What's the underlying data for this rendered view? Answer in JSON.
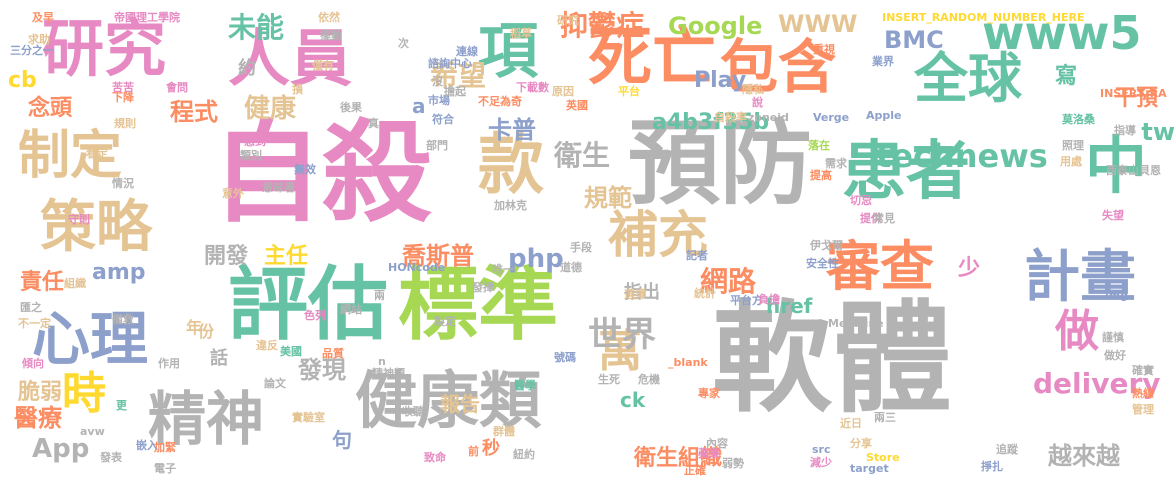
{
  "palette": {
    "pink": "#e78ac3",
    "gray": "#b3b3b3",
    "green": "#66c2a5",
    "tan": "#e5c494",
    "blue": "#8da0cb",
    "orange": "#fc8d62",
    "yellow": "#ffd92f",
    "lime": "#a6d854"
  },
  "words": [
    {
      "text": "自殺",
      "color": "pink"
    },
    {
      "text": "軟體",
      "color": "gray"
    },
    {
      "text": "預防",
      "color": "gray"
    },
    {
      "text": "評估",
      "color": "green"
    },
    {
      "text": "標準",
      "color": "lime"
    },
    {
      "text": "研究",
      "color": "pink"
    },
    {
      "text": "人員",
      "color": "pink"
    },
    {
      "text": "款",
      "color": "tan"
    },
    {
      "text": "患者",
      "color": "green"
    },
    {
      "text": "中",
      "color": "green"
    },
    {
      "text": "精神",
      "color": "gray"
    },
    {
      "text": "健康類",
      "color": "gray"
    },
    {
      "text": "心理",
      "color": "blue"
    },
    {
      "text": "策略",
      "color": "tan"
    },
    {
      "text": "制定",
      "color": "tan"
    },
    {
      "text": "死亡",
      "color": "orange"
    },
    {
      "text": "包含",
      "color": "orange"
    },
    {
      "text": "項",
      "color": "green"
    },
    {
      "text": "全球",
      "color": "green"
    },
    {
      "text": "www5",
      "color": "green"
    },
    {
      "text": "補充",
      "color": "tan"
    },
    {
      "text": "審查",
      "color": "orange"
    },
    {
      "text": "計畫",
      "color": "blue"
    },
    {
      "text": "時",
      "color": "yellow"
    },
    {
      "text": "做",
      "color": "pink"
    },
    {
      "text": "萬",
      "color": "tan"
    },
    {
      "text": "世界",
      "color": "gray"
    },
    {
      "text": "technews",
      "color": "green"
    },
    {
      "text": "delivery",
      "color": "pink"
    },
    {
      "text": "網路",
      "color": "orange"
    },
    {
      "text": "希望",
      "color": "tan"
    },
    {
      "text": "抑鬱症",
      "color": "orange"
    },
    {
      "text": "Google",
      "color": "lime"
    },
    {
      "text": "WWW",
      "color": "tan"
    },
    {
      "text": "BMC",
      "color": "blue"
    },
    {
      "text": "未能",
      "color": "green"
    },
    {
      "text": "健康",
      "color": "tan"
    },
    {
      "text": "程式",
      "color": "orange"
    },
    {
      "text": "衛生",
      "color": "gray"
    },
    {
      "text": "卡普",
      "color": "blue"
    },
    {
      "text": "規範",
      "color": "tan"
    },
    {
      "text": "a4b3f35b",
      "color": "green"
    },
    {
      "text": "Play",
      "color": "blue"
    },
    {
      "text": "喬斯普",
      "color": "orange"
    },
    {
      "text": "php",
      "color": "blue"
    },
    {
      "text": "amp",
      "color": "blue"
    },
    {
      "text": "開發",
      "color": "gray"
    },
    {
      "text": "主任",
      "color": "yellow"
    },
    {
      "text": "發現",
      "color": "gray"
    },
    {
      "text": "醫療",
      "color": "orange"
    },
    {
      "text": "脆弱",
      "color": "tan"
    },
    {
      "text": "責任",
      "color": "orange"
    },
    {
      "text": "App",
      "color": "gray"
    },
    {
      "text": "越來越",
      "color": "gray"
    },
    {
      "text": "衛生組織",
      "color": "orange"
    },
    {
      "text": "念頭",
      "color": "orange"
    },
    {
      "text": "cb",
      "color": "yellow"
    },
    {
      "text": "tw",
      "color": "green"
    },
    {
      "text": "干預",
      "color": "orange"
    },
    {
      "text": "寫",
      "color": "green"
    },
    {
      "text": "報告",
      "color": "tan"
    },
    {
      "text": "href",
      "color": "green"
    },
    {
      "text": "指出",
      "color": "gray"
    },
    {
      "text": "少",
      "color": "pink"
    },
    {
      "text": "年",
      "color": "tan"
    },
    {
      "text": "話",
      "color": "gray"
    },
    {
      "text": "句",
      "color": "blue"
    },
    {
      "text": "ck",
      "color": "green"
    },
    {
      "text": "a",
      "color": "blue"
    },
    {
      "text": "秒",
      "color": "orange"
    },
    {
      "text": "份",
      "color": "tan"
    },
    {
      "text": "約",
      "color": "gray"
    },
    {
      "text": "INSERT_RANDOM_NUMBER_HERE",
      "color": "yellow"
    },
    {
      "text": "帝國理工學院",
      "color": "pink"
    },
    {
      "text": "依然",
      "color": "tan"
    },
    {
      "text": "研究",
      "color": "tan"
    },
    {
      "text": "及早",
      "color": "orange"
    },
    {
      "text": "求助",
      "color": "tan"
    },
    {
      "text": "三分之一",
      "color": "blue"
    },
    {
      "text": "苦苦",
      "color": "pink"
    },
    {
      "text": "僅有",
      "color": "tan"
    },
    {
      "text": "市場",
      "color": "blue"
    },
    {
      "text": "連線",
      "color": "blue"
    },
    {
      "text": "次",
      "color": "gray"
    },
    {
      "text": "下載數",
      "color": "pink"
    },
    {
      "text": "原因",
      "color": "tan"
    },
    {
      "text": "英國",
      "color": "orange"
    },
    {
      "text": "平台",
      "color": "yellow"
    },
    {
      "text": "Apple",
      "color": "blue"
    },
    {
      "text": "重視",
      "color": "orange"
    },
    {
      "text": "業界",
      "color": "blue"
    },
    {
      "text": "INSERT_RA",
      "color": "orange"
    },
    {
      "text": "指導",
      "color": "gray"
    },
    {
      "text": "莫洛桑",
      "color": "green"
    },
    {
      "text": "照理",
      "color": "gray"
    },
    {
      "text": "用處",
      "color": "tan"
    },
    {
      "text": "西泰山貝恩",
      "color": "gray"
    },
    {
      "text": "Verge",
      "color": "blue"
    },
    {
      "text": "zoneid",
      "color": "gray"
    },
    {
      "text": "自殺率",
      "color": "tan"
    },
    {
      "text": "提高",
      "color": "orange"
    },
    {
      "text": "需求",
      "color": "gray"
    },
    {
      "text": "落在",
      "color": "lime"
    },
    {
      "text": "切忌",
      "color": "pink"
    },
    {
      "text": "提供",
      "color": "pink"
    },
    {
      "text": "失望",
      "color": "pink"
    },
    {
      "text": "常見",
      "color": "gray"
    },
    {
      "text": "img",
      "color": "blue"
    },
    {
      "text": "伊戈爾",
      "color": "gray"
    },
    {
      "text": "安全性",
      "color": "blue"
    },
    {
      "text": "記者",
      "color": "blue"
    },
    {
      "text": "手段",
      "color": "gray"
    },
    {
      "text": "道德",
      "color": "gray"
    },
    {
      "text": "唯一",
      "color": "gray"
    },
    {
      "text": "HONcode",
      "color": "blue"
    },
    {
      "text": "加林克",
      "color": "gray"
    },
    {
      "text": "統計",
      "color": "tan"
    },
    {
      "text": "選擇",
      "color": "tan"
    },
    {
      "text": "平台方",
      "color": "blue"
    },
    {
      "text": "負擔",
      "color": "pink"
    },
    {
      "text": "謹慎",
      "color": "gray"
    },
    {
      "text": "Medicine",
      "color": "gray"
    },
    {
      "text": "做好",
      "color": "gray"
    },
    {
      "text": "確實",
      "color": "gray"
    },
    {
      "text": "熱線",
      "color": "orange"
    },
    {
      "text": "管理",
      "color": "tan"
    },
    {
      "text": "兩三",
      "color": "gray"
    },
    {
      "text": "近日",
      "color": "tan"
    },
    {
      "text": "分享",
      "color": "tan"
    },
    {
      "text": "追蹤",
      "color": "gray"
    },
    {
      "text": "掙扎",
      "color": "blue"
    },
    {
      "text": "src",
      "color": "blue"
    },
    {
      "text": "Store",
      "color": "yellow"
    },
    {
      "text": "target",
      "color": "blue"
    },
    {
      "text": "減少",
      "color": "pink"
    },
    {
      "text": "弱勢",
      "color": "gray"
    },
    {
      "text": "正確",
      "color": "orange"
    },
    {
      "text": "蘋果",
      "color": "pink"
    },
    {
      "text": "專家",
      "color": "orange"
    },
    {
      "text": "內容",
      "color": "gray"
    },
    {
      "text": "危機",
      "color": "gray"
    },
    {
      "text": "_blank",
      "color": "orange"
    },
    {
      "text": "生死",
      "color": "gray"
    },
    {
      "text": "號碼",
      "color": "blue"
    },
    {
      "text": "醫學",
      "color": "green"
    },
    {
      "text": "紐約",
      "color": "gray"
    },
    {
      "text": "群體",
      "color": "tan"
    },
    {
      "text": "前",
      "color": "orange"
    },
    {
      "text": "致命",
      "color": "pink"
    },
    {
      "text": "精神類",
      "color": "gray"
    },
    {
      "text": "論文",
      "color": "gray"
    },
    {
      "text": "美國",
      "color": "green"
    },
    {
      "text": "品質",
      "color": "orange"
    },
    {
      "text": "違反",
      "color": "tan"
    },
    {
      "text": "收聽",
      "color": "gray"
    },
    {
      "text": "實驗室",
      "color": "tan"
    },
    {
      "text": "加緊",
      "color": "orange"
    },
    {
      "text": "電子",
      "color": "gray"
    },
    {
      "text": "發表",
      "color": "gray"
    },
    {
      "text": "嵌入",
      "color": "blue"
    },
    {
      "text": "avw",
      "color": "gray"
    },
    {
      "text": "更",
      "color": "green"
    },
    {
      "text": "作用",
      "color": "gray"
    },
    {
      "text": "備救",
      "color": "gray"
    },
    {
      "text": "不一定",
      "color": "tan"
    },
    {
      "text": "組織",
      "color": "tan"
    },
    {
      "text": "匯之",
      "color": "gray"
    },
    {
      "text": "傾向",
      "color": "pink"
    },
    {
      "text": "網站",
      "color": "gray"
    },
    {
      "text": "色列",
      "color": "pink"
    },
    {
      "text": "n",
      "color": "gray"
    },
    {
      "text": "兩",
      "color": "gray"
    },
    {
      "text": "製定",
      "color": "gray"
    },
    {
      "text": "發揮",
      "color": "gray"
    },
    {
      "text": "無效",
      "color": "blue"
    },
    {
      "text": "意味著",
      "color": "gray"
    },
    {
      "text": "意外",
      "color": "tan"
    },
    {
      "text": "情況",
      "color": "gray"
    },
    {
      "text": "守則",
      "color": "pink"
    },
    {
      "text": "看定",
      "color": "tan"
    },
    {
      "text": "類別",
      "color": "gray"
    },
    {
      "text": "感到",
      "color": "pink"
    },
    {
      "text": "規則",
      "color": "tan"
    },
    {
      "text": "下降",
      "color": "orange"
    },
    {
      "text": "會問",
      "color": "pink"
    },
    {
      "text": "損",
      "color": "tan"
    },
    {
      "text": "後果",
      "color": "gray"
    },
    {
      "text": "真",
      "color": "gray"
    },
    {
      "text": "符合",
      "color": "blue"
    },
    {
      "text": "部門",
      "color": "gray"
    },
    {
      "text": "不足為奇",
      "color": "orange"
    },
    {
      "text": "擔起",
      "color": "gray"
    },
    {
      "text": "沒",
      "color": "gray"
    },
    {
      "text": "說",
      "color": "pink"
    },
    {
      "text": "隱私",
      "color": "tan"
    },
    {
      "text": "諮詢中心",
      "color": "blue"
    },
    {
      "text": "稻草",
      "color": "tan"
    },
    {
      "text": "擺動",
      "color": "gray"
    }
  ]
}
